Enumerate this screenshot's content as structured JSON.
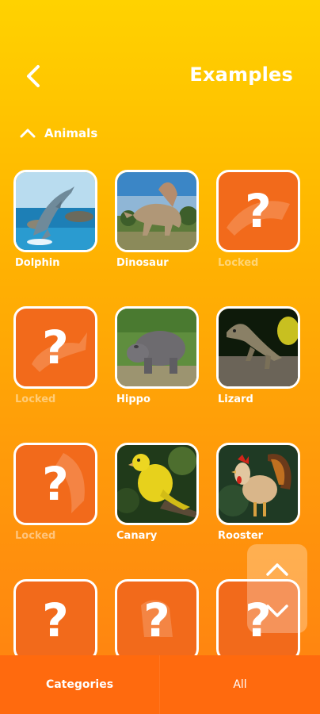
{
  "header": {
    "title": "Examples",
    "back_icon": "chevron-left-icon"
  },
  "section": {
    "title": "Animals",
    "expanded": true,
    "toggle_icon": "chevron-up-icon"
  },
  "items": [
    {
      "label": "Dolphin",
      "locked": false
    },
    {
      "label": "Dinosaur",
      "locked": false
    },
    {
      "label": "Locked",
      "locked": true
    },
    {
      "label": "Locked",
      "locked": true
    },
    {
      "label": "Hippo",
      "locked": false
    },
    {
      "label": "Lizard",
      "locked": false
    },
    {
      "label": "Locked",
      "locked": true
    },
    {
      "label": "Canary",
      "locked": false
    },
    {
      "label": "Rooster",
      "locked": false
    },
    {
      "label": "",
      "locked": true
    },
    {
      "label": "",
      "locked": true
    },
    {
      "label": "",
      "locked": true
    }
  ],
  "locked_glyph": "?",
  "scroll_controls": {
    "up_icon": "chevron-up-icon",
    "down_icon": "chevron-down-icon"
  },
  "bottom_nav": {
    "categories_label": "Categories",
    "all_label": "All"
  },
  "colors": {
    "tile_border": "#ffffff",
    "locked_tile": "#f26a1b",
    "bottom_bar": "#ff6a0e"
  }
}
